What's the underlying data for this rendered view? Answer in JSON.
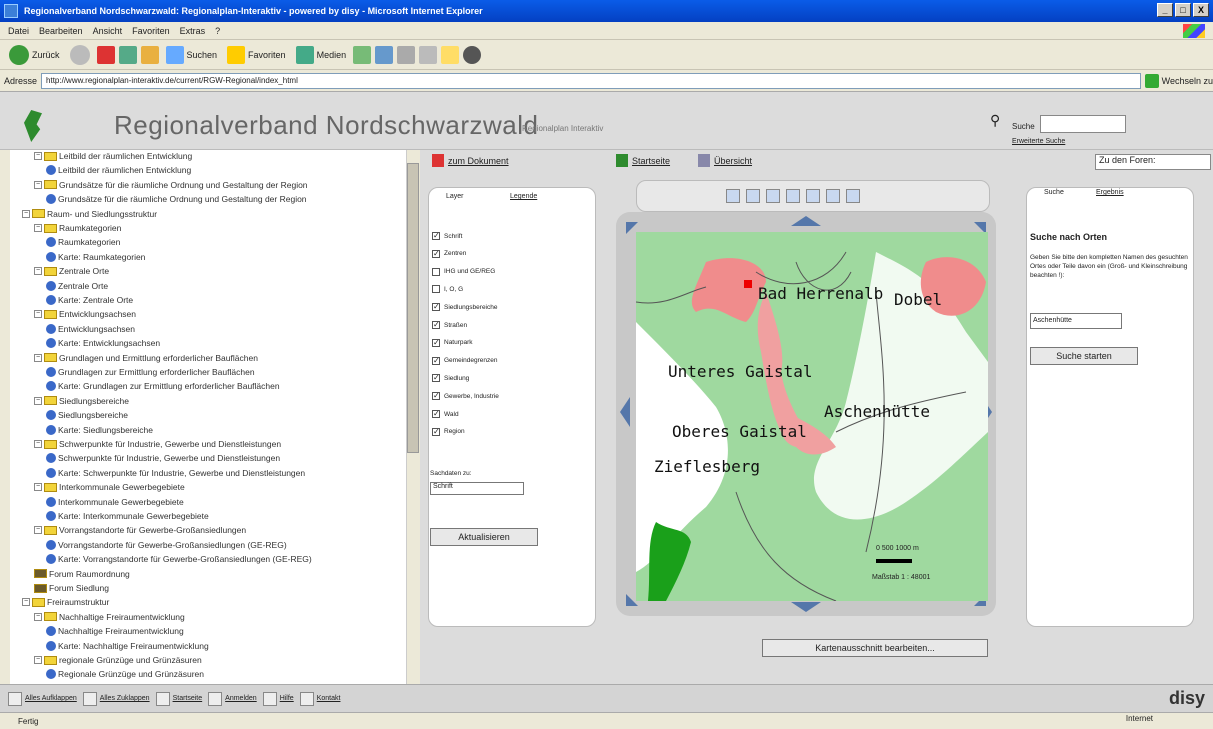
{
  "window": {
    "title": "Regionalverband Nordschwarzwald: Regionalplan-Interaktiv - powered by disy - Microsoft Internet Explorer",
    "min": "_",
    "max": "□",
    "close": "X"
  },
  "menu": [
    "Datei",
    "Bearbeiten",
    "Ansicht",
    "Favoriten",
    "Extras",
    "?"
  ],
  "toolbar": {
    "back": "Zurück",
    "search": "Suchen",
    "favorites": "Favoriten",
    "media": "Medien"
  },
  "address": {
    "label": "Adresse",
    "url": "http://www.regionalplan-interaktiv.de/current/RGW-Regional/index_html",
    "go": "Wechseln zu"
  },
  "header": {
    "title": "Regionalverband Nordschwarzwald",
    "subtitle": "Regionalplan Interaktiv",
    "search_label": "Suche",
    "advanced": "Erweiterte Suche"
  },
  "tree": [
    {
      "d": 2,
      "t": "Leitbild der räumlichen Entwicklung",
      "k": "f"
    },
    {
      "d": 3,
      "t": "Leitbild der räumlichen Entwicklung",
      "k": "d"
    },
    {
      "d": 2,
      "t": "Grundsätze für die räumliche Ordnung und Gestaltung der Region",
      "k": "f"
    },
    {
      "d": 3,
      "t": "Grundsätze für die räumliche Ordnung und Gestaltung der Region",
      "k": "d"
    },
    {
      "d": 1,
      "t": "Raum- und Siedlungsstruktur",
      "k": "f"
    },
    {
      "d": 2,
      "t": "Raumkategorien",
      "k": "f"
    },
    {
      "d": 3,
      "t": "Raumkategorien",
      "k": "d"
    },
    {
      "d": 3,
      "t": "Karte: Raumkategorien",
      "k": "d"
    },
    {
      "d": 2,
      "t": "Zentrale Orte",
      "k": "f"
    },
    {
      "d": 3,
      "t": "Zentrale Orte",
      "k": "d"
    },
    {
      "d": 3,
      "t": "Karte: Zentrale Orte",
      "k": "d"
    },
    {
      "d": 2,
      "t": "Entwicklungsachsen",
      "k": "f"
    },
    {
      "d": 3,
      "t": "Entwicklungsachsen",
      "k": "d"
    },
    {
      "d": 3,
      "t": "Karte: Entwicklungsachsen",
      "k": "d"
    },
    {
      "d": 2,
      "t": "Grundlagen und Ermittlung erforderlicher Bauflächen",
      "k": "f"
    },
    {
      "d": 3,
      "t": "Grundlagen zur Ermittlung erforderlicher Bauflächen",
      "k": "d"
    },
    {
      "d": 3,
      "t": "Karte: Grundlagen zur Ermittlung erforderlicher Bauflächen",
      "k": "d"
    },
    {
      "d": 2,
      "t": "Siedlungsbereiche",
      "k": "f"
    },
    {
      "d": 3,
      "t": "Siedlungsbereiche",
      "k": "d"
    },
    {
      "d": 3,
      "t": "Karte: Siedlungsbereiche",
      "k": "d"
    },
    {
      "d": 2,
      "t": "Schwerpunkte für Industrie, Gewerbe und Dienstleistungen",
      "k": "f"
    },
    {
      "d": 3,
      "t": "Schwerpunkte für Industrie, Gewerbe und Dienstleistungen",
      "k": "d"
    },
    {
      "d": 3,
      "t": "Karte: Schwerpunkte für Industrie, Gewerbe und Dienstleistungen",
      "k": "d"
    },
    {
      "d": 2,
      "t": "Interkommunale Gewerbegebiete",
      "k": "f"
    },
    {
      "d": 3,
      "t": "Interkommunale Gewerbegebiete",
      "k": "d"
    },
    {
      "d": 3,
      "t": "Karte: Interkommunale Gewerbegebiete",
      "k": "d"
    },
    {
      "d": 2,
      "t": "Vorrangstandorte für Gewerbe-Großansiedlungen",
      "k": "f"
    },
    {
      "d": 3,
      "t": "Vorrangstandorte für Gewerbe-Großansiedlungen (GE-REG)",
      "k": "d"
    },
    {
      "d": 3,
      "t": "Karte: Vorrangstandorte für Gewerbe-Großansiedlungen (GE-REG)",
      "k": "d"
    },
    {
      "d": 2,
      "t": "Forum Raumordnung",
      "k": "b"
    },
    {
      "d": 2,
      "t": "Forum Siedlung",
      "k": "b"
    },
    {
      "d": 1,
      "t": "Freiraumstruktur",
      "k": "f"
    },
    {
      "d": 2,
      "t": "Nachhaltige Freiraumentwicklung",
      "k": "f"
    },
    {
      "d": 3,
      "t": "Nachhaltige Freiraumentwicklung",
      "k": "d"
    },
    {
      "d": 3,
      "t": "Karte: Nachhaltige Freiraumentwicklung",
      "k": "d"
    },
    {
      "d": 2,
      "t": "regionale Grünzüge und Grünzäsuren",
      "k": "f"
    },
    {
      "d": 3,
      "t": "Regionale Grünzüge und Grünzäsuren",
      "k": "d"
    }
  ],
  "links": {
    "doc": "zum Dokument",
    "start": "Startseite",
    "overview": "Übersicht",
    "forum": "Zu den Foren:"
  },
  "left_panel": {
    "tab_layer": "Layer",
    "tab_legend": "Legende",
    "layers": [
      {
        "l": "Schrift",
        "c": true
      },
      {
        "l": "Zentren",
        "c": true
      },
      {
        "l": "IHG und GE/REG",
        "c": false
      },
      {
        "l": "I, O, G",
        "c": false
      },
      {
        "l": "Siedlungsbereiche",
        "c": true
      },
      {
        "l": "Straßen",
        "c": true
      },
      {
        "l": "Naturpark",
        "c": true
      },
      {
        "l": "Gemeindegrenzen",
        "c": true
      },
      {
        "l": "Siedlung",
        "c": true
      },
      {
        "l": "Gewerbe, Industrie",
        "c": true
      },
      {
        "l": "Wald",
        "c": true
      },
      {
        "l": "Region",
        "c": true
      }
    ],
    "sach_label": "Sachdaten zu:",
    "sach_value": "Schrift",
    "refresh": "Aktualisieren"
  },
  "map": {
    "labels": [
      "Bad Herrenalb",
      "Dobel",
      "Unteres Gaistal",
      "Aschenhütte",
      "Oberes Gaistal",
      "Zieflesberg"
    ],
    "scale_bar": "0   500 1000 m",
    "scale": "Maßstab 1 : 48001",
    "edit": "Kartenausschnitt bearbeiten..."
  },
  "right_panel": {
    "tab_search": "Suche",
    "tab_results": "Ergebnis",
    "heading": "Suche nach Orten",
    "help": "Geben Sie bitte den kompletten Namen des gesuchten Ortes oder Teile davon ein (Groß- und Kleinschreibung beachten !):",
    "value": "Aschenhütte",
    "button": "Suche starten"
  },
  "bottom": {
    "collapse": "Alles Aufklappen",
    "expand": "Alles Zuklappen",
    "start": "Startseite",
    "login": "Anmelden",
    "help": "Hilfe",
    "contact": "Kontakt",
    "brand": "disy"
  },
  "status": {
    "text": "Fertig",
    "zone": "Internet"
  }
}
